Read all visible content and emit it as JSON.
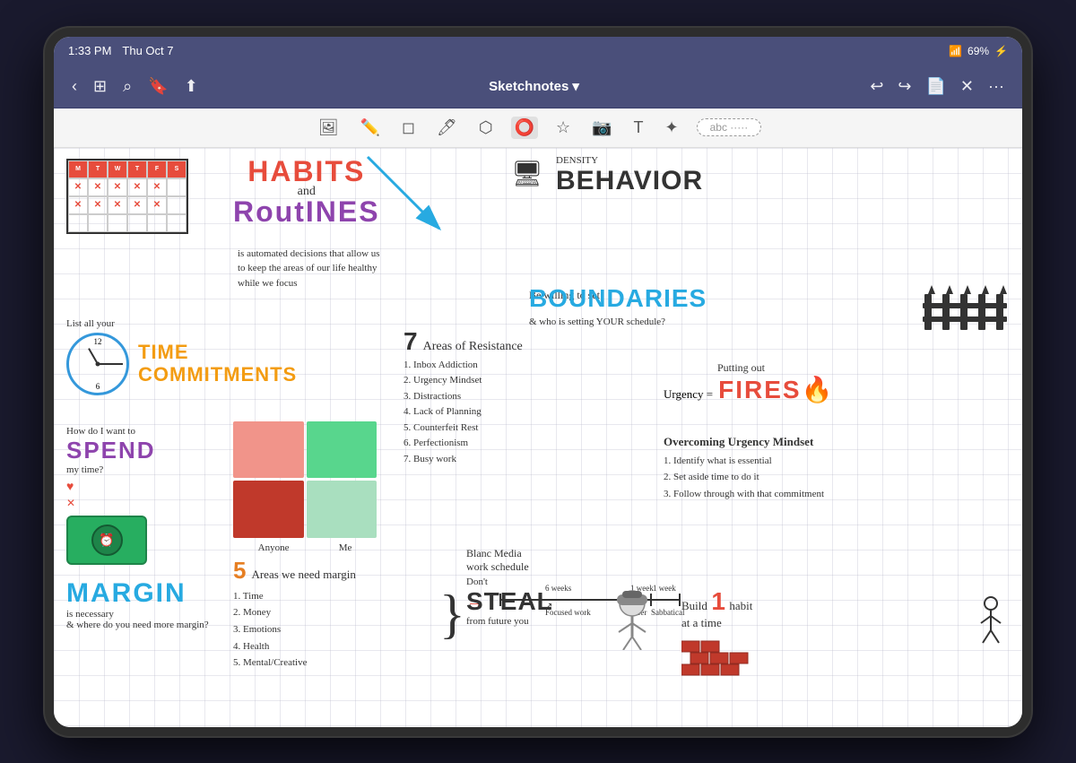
{
  "device": {
    "title": "iPad"
  },
  "statusBar": {
    "time": "1:33 PM",
    "date": "Thu Oct 7",
    "battery": "69%",
    "batterySymbol": "🔋",
    "wifi": "WiFi"
  },
  "toolbar": {
    "title": "Sketchnotes",
    "titleChevron": "▾",
    "backLabel": "‹",
    "gridLabel": "⊞",
    "searchLabel": "⌕",
    "bookmarkLabel": "🔖",
    "shareLabel": "⬆",
    "undoLabel": "↩",
    "redoLabel": "↪",
    "addPageLabel": "⊕",
    "closeLabel": "✕",
    "moreLabel": "···"
  },
  "drawingToolbar": {
    "imageLabel": "🖼",
    "penLabel": "✏",
    "eraserLabel": "◻",
    "markerLabel": "🖊",
    "colorLabel": "⬡",
    "lassoLabel": "⭕",
    "starLabel": "☆",
    "photoLabel": "📷",
    "textLabel": "T",
    "highlightLabel": "✦",
    "textPill": "abc ·····"
  },
  "sketchnote": {
    "habitsTitle": "HABITS",
    "habitsAnd": "and",
    "routinesTitle": "RoutINES",
    "routinesDesc": "is automated decisions that allow us to keep the areas of our life healthy while we focus",
    "behaviorTitle": "BEHAVIOR",
    "behaviorSub": "DENSITY",
    "boundariesTitle": "BOUNDARIES",
    "beWillingText": "Be willing to set",
    "whoSetsSchedule": "& who is setting YOUR schedule?",
    "timeLabel": "List all your",
    "timeTitle": "TIME\nCOMMITMENTS",
    "areasNum": "7",
    "areasTitle": "Areas of Resistance",
    "areasList": [
      "1. Inbox Addiction",
      "2. Urgency Mindset",
      "3. Distractions",
      "4. Lack of Planning",
      "5. Counterfeit Rest",
      "6. Perfectionism",
      "7. Busy work"
    ],
    "howDoIText": "How do I want to",
    "spendTitle": "SPEND",
    "myTimeText": "my time?",
    "matrixLabels": [
      "Anyone",
      "Me"
    ],
    "urgencyText": "Urgency =",
    "puttingOutText": "Putting out",
    "firesTitle": "FIRES🔥",
    "overcomingTitle": "Overcoming Urgency Mindset",
    "overcomingList": [
      "1. Identify what is essential",
      "2. Set aside time to do it",
      "3. Follow through with that commitment"
    ],
    "marginNum": "5",
    "marginAreasTitle": "Areas we need margin",
    "marginList": [
      "1. Time",
      "2. Money",
      "3. Emotions",
      "4. Health",
      "5. Mental/Creative"
    ],
    "marginTitle": "MARGIN",
    "marginSub": "is necessary",
    "marginQuestion": "& where do you need more margin?",
    "blancMediaTitle": "Blanc Media\nwork schedule",
    "scheduleWeeks": [
      "6 weeks",
      "1 week",
      "1 week"
    ],
    "scheduleLabels": [
      "Focused work",
      "Buffer",
      "Sabbatical"
    ],
    "dontText": "Don't",
    "stealTitle": "STEAL",
    "stealFrom": "from future you",
    "buildText": "Build",
    "buildNum": "1",
    "habitText": "habit",
    "atATime": "at a time"
  }
}
